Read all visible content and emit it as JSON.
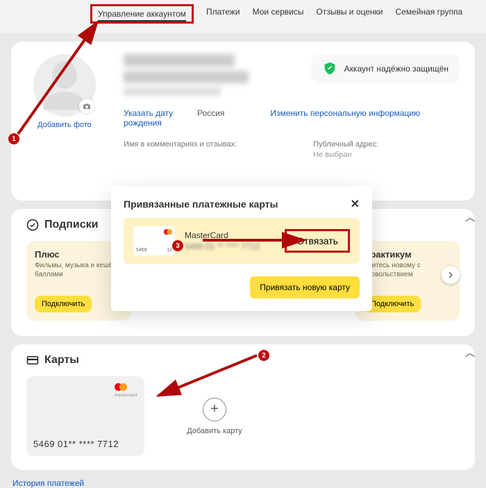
{
  "tabs": {
    "active": "Управление аккаунтом",
    "items": [
      "Управление аккаунтом",
      "Платежи",
      "Мои сервисы",
      "Отзывы и оценки",
      "Семейная группа"
    ]
  },
  "profile": {
    "add_photo": "Добавить фото",
    "birthday_link": "Указать дату рождения",
    "country": "Россия",
    "edit_link": "Изменить персональную информацию",
    "comment_name_label": "Имя в комментариях и отзывах:",
    "public_addr_label": "Публичный адрес:",
    "public_addr_value": "Не выбран"
  },
  "secure": {
    "text": "Аккаунт надёжно защищён"
  },
  "subs": {
    "title": "Подписки",
    "cards": [
      {
        "title": "Плюс",
        "desc": "Фильмы, музыка и кешбэк баллами",
        "btn": "Подключить"
      },
      {
        "title": "Практикум",
        "desc": "Учитесь новому с удовольствием",
        "btn": "Подключить"
      }
    ]
  },
  "cards": {
    "title": "Карты",
    "brand": "mastercard",
    "number": "5469 01** **** 7712",
    "add_label": "Добавить карту",
    "history": "История платежей"
  },
  "modal": {
    "title": "Привязанные платежные карты",
    "card_brand": "MasterCard",
    "mini_left": "5469",
    "mini_right": "12",
    "unlink": "Отвязать",
    "attach_new": "Привязать новую карту"
  },
  "steps": {
    "s1": "1",
    "s2": "2",
    "s3": "3"
  }
}
